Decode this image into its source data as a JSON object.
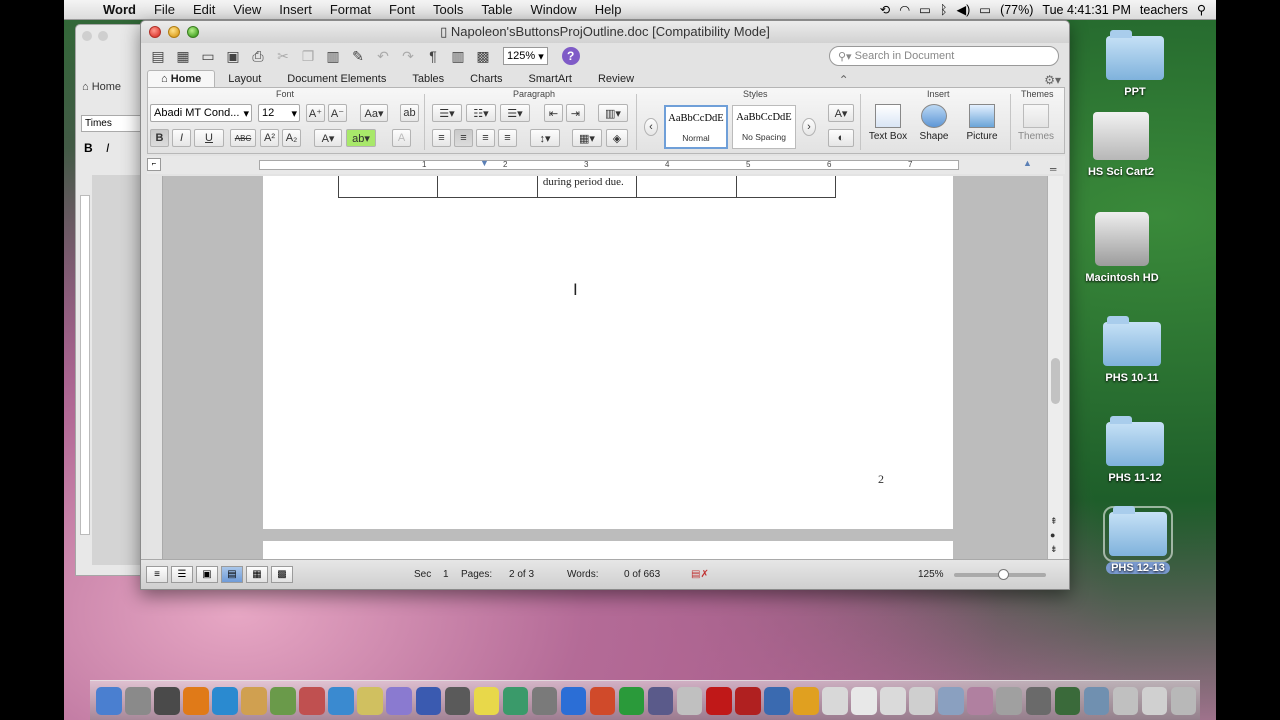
{
  "menubar": {
    "app": "Word",
    "items": [
      "File",
      "Edit",
      "View",
      "Insert",
      "Format",
      "Font",
      "Tools",
      "Table",
      "Window",
      "Help"
    ],
    "battery": "(77%)",
    "clock": "Tue 4:41:31 PM",
    "user": "teachers"
  },
  "window": {
    "title": "Napoleon'sButtonsProjOutline.doc [Compatibility Mode]",
    "zoom": "125%",
    "search_placeholder": "Search in Document",
    "tabs": [
      "Home",
      "Layout",
      "Document Elements",
      "Tables",
      "Charts",
      "SmartArt",
      "Review"
    ]
  },
  "ribbon": {
    "groups": {
      "font": "Font",
      "paragraph": "Paragraph",
      "styles": "Styles",
      "insert": "Insert",
      "themes": "Themes"
    },
    "font_name": "Abadi MT Cond...",
    "font_size": "12",
    "styles": [
      {
        "sample": "AaBbCcDdE",
        "name": "Normal"
      },
      {
        "sample": "AaBbCcDdE",
        "name": "No Spacing"
      }
    ],
    "insert_buttons": [
      "Text Box",
      "Shape",
      "Picture"
    ],
    "themes_button": "Themes",
    "bold": "B",
    "italic": "I",
    "underline": "U",
    "strike": "ABC"
  },
  "ruler_numbers": [
    "1",
    "2",
    "3",
    "4",
    "5",
    "6",
    "7"
  ],
  "document": {
    "table_cells": [
      "",
      "",
      "during period due.",
      "",
      ""
    ],
    "page_number": "2"
  },
  "statusbar": {
    "sec_label": "Sec",
    "sec": "1",
    "pages_label": "Pages:",
    "pages": "2 of 3",
    "words_label": "Words:",
    "words": "0 of 663",
    "zoom": "125%"
  },
  "bgwin": {
    "home": "Home",
    "font": "Times"
  },
  "desktop": [
    {
      "label": "PPT",
      "kind": "folder"
    },
    {
      "label": "HS Sci Cart2",
      "kind": "printer"
    },
    {
      "label": "Macintosh HD",
      "kind": "disk"
    },
    {
      "label": "PHS 10-11",
      "kind": "folder"
    },
    {
      "label": "PHS 11-12",
      "kind": "folder"
    },
    {
      "label": "PHS 12-13",
      "kind": "folder",
      "selected": true
    }
  ],
  "dock_apps": [
    {
      "icon": "finder-icon",
      "color": "#4a7fd0"
    },
    {
      "icon": "launchpad-icon",
      "color": "#8a8a8a"
    },
    {
      "icon": "mission-control-icon",
      "color": "#4a4a4a"
    },
    {
      "icon": "firefox-icon",
      "color": "#e07a18"
    },
    {
      "icon": "people-icon",
      "color": "#2a8ad0"
    },
    {
      "icon": "photo-icon",
      "color": "#d0a050"
    },
    {
      "icon": "iphoto-icon",
      "color": "#6a9a4a"
    },
    {
      "icon": "presentation-icon",
      "color": "#c05050"
    },
    {
      "icon": "safari-icon",
      "color": "#3a8ad0"
    },
    {
      "icon": "notes-icon",
      "color": "#d0c060"
    },
    {
      "icon": "preview-icon",
      "color": "#8a7ad0"
    },
    {
      "icon": "calculator-icon",
      "color": "#3a5ab0"
    },
    {
      "icon": "pen-icon",
      "color": "#5a5a5a"
    },
    {
      "icon": "stickies-icon",
      "color": "#e8d84a"
    },
    {
      "icon": "charts-icon",
      "color": "#3a9a6a"
    },
    {
      "icon": "system-prefs-icon",
      "color": "#7a7a7a"
    },
    {
      "icon": "word-icon",
      "color": "#2b6ed6"
    },
    {
      "icon": "powerpoint-icon",
      "color": "#d04a2a"
    },
    {
      "icon": "excel-icon",
      "color": "#2a9a3a"
    },
    {
      "icon": "camera-icon",
      "color": "#5a5a8a"
    },
    {
      "icon": "photobooth-icon",
      "color": "#c0c0c0"
    },
    {
      "icon": "acrobat-icon",
      "color": "#c01818"
    },
    {
      "icon": "pdf-icon",
      "color": "#b02020"
    },
    {
      "icon": "quicktime-icon",
      "color": "#3a6ab0"
    },
    {
      "icon": "flower-icon",
      "color": "#e0a020"
    },
    {
      "icon": "textedit-icon",
      "color": "#d8d8d8"
    },
    {
      "icon": "document-icon",
      "color": "#e8e8e8"
    },
    {
      "icon": "document2-icon",
      "color": "#dadada"
    },
    {
      "icon": "document3-icon",
      "color": "#cfcfcf"
    },
    {
      "icon": "window-thumb-icon",
      "color": "#8aa0c0"
    },
    {
      "icon": "window-thumb2-icon",
      "color": "#b080a0"
    },
    {
      "icon": "window-thumb3-icon",
      "color": "#a0a0a0"
    },
    {
      "icon": "window-thumb4-icon",
      "color": "#6a6a6a"
    },
    {
      "icon": "window-thumb5-icon",
      "color": "#3a6a3a"
    },
    {
      "icon": "window-thumb6-icon",
      "color": "#7090b0"
    },
    {
      "icon": "window-thumb7-icon",
      "color": "#c0c0c0"
    },
    {
      "icon": "window-thumb8-icon",
      "color": "#d0d0d0"
    },
    {
      "icon": "trash-icon",
      "color": "#b8b8b8"
    }
  ]
}
